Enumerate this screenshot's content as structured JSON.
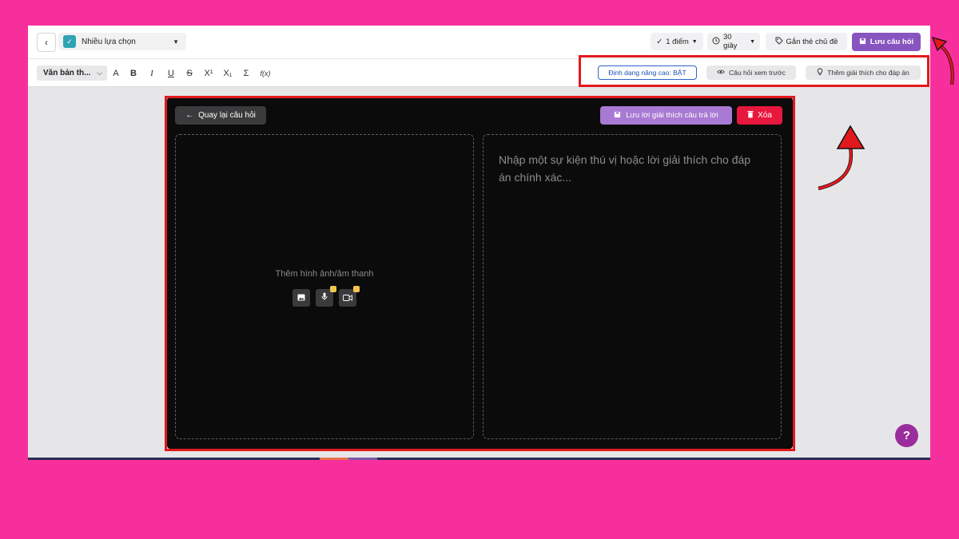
{
  "topbar": {
    "question_type": "Nhiều lựa chọn",
    "points": "1 điểm",
    "time": "30 giây",
    "tag_label": "Gắn thẻ chủ đề",
    "save_label": "Lưu câu hỏi"
  },
  "toolbar": {
    "font_style": "Văn bản th...",
    "format_buttons": [
      "A",
      "B",
      "I",
      "U",
      "S",
      "X¹",
      "X₁",
      "Σ",
      "f(x)"
    ],
    "advanced_format": "Định dạng nâng cao: BẬT",
    "preview": "Câu hỏi xem trước",
    "add_explanation": "Thêm giải thích cho đáp án"
  },
  "editor": {
    "back_label": "Quay lại câu hỏi",
    "save_explanation_label": "Lưu lời giải thích câu trả lời",
    "delete_label": "Xóa",
    "media_label": "Thêm hình ảnh/âm thanh",
    "media_buttons": [
      "image-icon",
      "mic-icon",
      "video-icon"
    ],
    "text_placeholder": "Nhập một sự kiện thú vị hoặc lời giải thích cho đáp án chính xác..."
  },
  "help": {
    "label": "?"
  },
  "colors": {
    "background": "#f72f9c",
    "accent_purple": "#8854c0",
    "light_purple": "#a97ad3",
    "delete_red": "#e8173e",
    "highlight_red": "#e2191c",
    "help_purple": "#9b2c9d",
    "editor_bg": "#0b0b0c"
  }
}
